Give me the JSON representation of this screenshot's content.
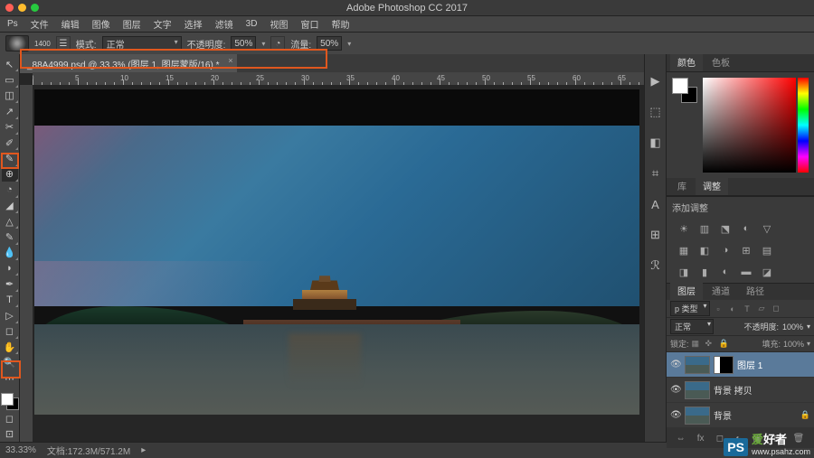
{
  "app_title": "Adobe Photoshop CC 2017",
  "menu": [
    "Ps",
    "文件",
    "编辑",
    "图像",
    "图层",
    "文字",
    "选择",
    "滤镜",
    "3D",
    "视图",
    "窗口",
    "帮助"
  ],
  "options": {
    "brush_size": "1400",
    "mode_label": "模式:",
    "mode_value": "正常",
    "opacity_label": "不透明度:",
    "opacity_value": "50%",
    "flow_label": "流量:",
    "flow_value": "50%"
  },
  "doc_tab": "_88A4999.psd @ 33.3% (图层 1, 图层蒙版/16) *",
  "status": {
    "zoom": "33.33%",
    "docsize": "文档:172.3M/571.2M"
  },
  "tools": [
    "↖",
    "▭",
    "◫",
    "↗",
    "✂",
    "✐",
    "✎",
    "⊕",
    "◔",
    "◢",
    "△",
    "✎",
    "⊥",
    "▯",
    "T",
    "▷",
    "◻",
    "✋",
    "🔍"
  ],
  "narrow_icons": [
    "▶",
    "⬚",
    "◧",
    "⌗",
    "A",
    "⊞",
    "ℛ"
  ],
  "color_tabs": {
    "t1": "颜色",
    "t2": "色板"
  },
  "adj_tabs": {
    "t1": "库",
    "t2": "调整"
  },
  "adj_header": "添加调整",
  "layer_tabs": {
    "t1": "图层",
    "t2": "通道",
    "t3": "路径"
  },
  "layer_filter": "p 类型",
  "blend": {
    "mode": "正常",
    "opacity_l": "不透明度:",
    "opacity_v": "100%"
  },
  "lock": {
    "label": "锁定:",
    "fill_l": "填充:",
    "fill_v": "100%"
  },
  "layers": [
    {
      "name": "图层 1",
      "mask": true,
      "sel": true
    },
    {
      "name": "背景 拷贝",
      "mask": false,
      "sel": false
    },
    {
      "name": "背景",
      "mask": false,
      "sel": false
    }
  ],
  "watermark": {
    "brand_green": "爱",
    "brand_white": "好者",
    "url": "www.psahz.com"
  }
}
